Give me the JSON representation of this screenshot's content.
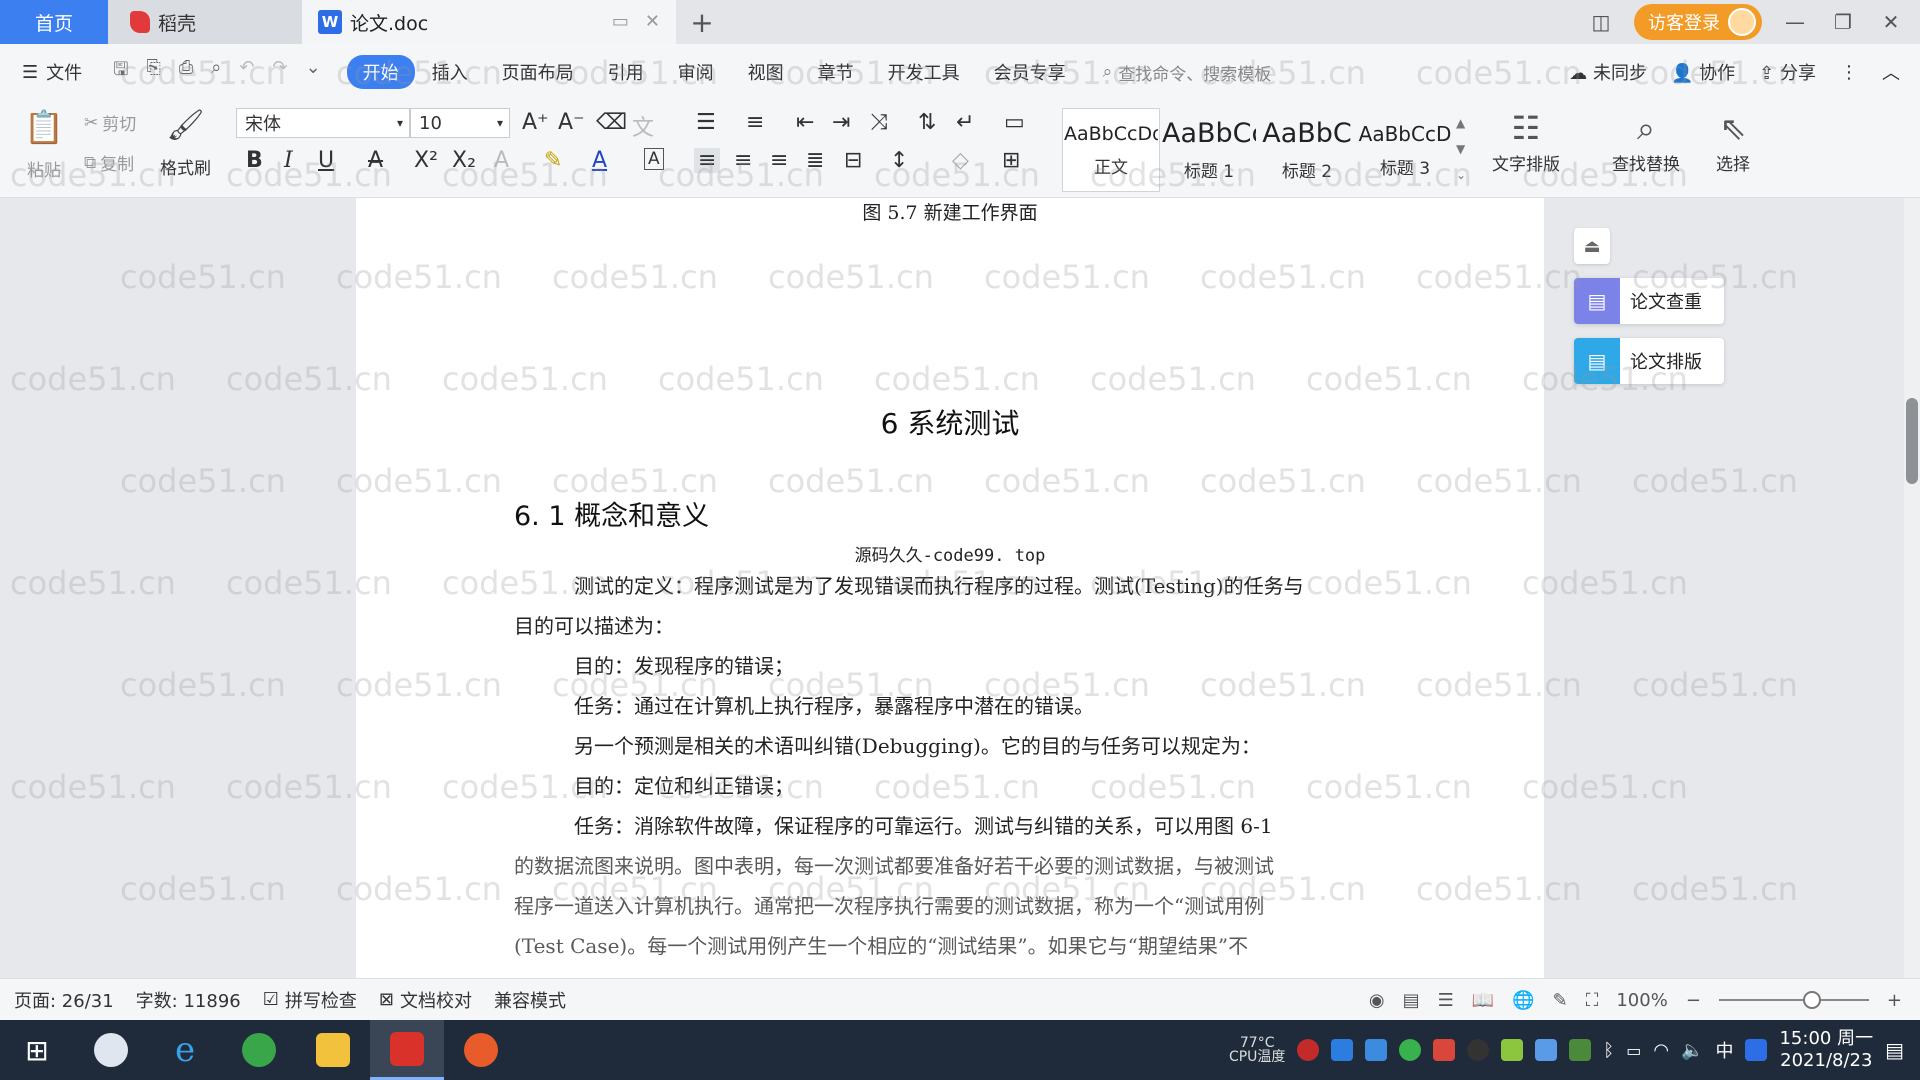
{
  "tabs": {
    "home": "首页",
    "daoke": "稻壳",
    "doc": "论文.doc",
    "doc_icon": "W",
    "new_tab": "+"
  },
  "title_right": {
    "login": "访客登录"
  },
  "menu": {
    "file": "文件",
    "items": [
      "开始",
      "插入",
      "页面布局",
      "引用",
      "审阅",
      "视图",
      "章节",
      "开发工具",
      "会员专享"
    ],
    "search_placeholder": "查找命令、搜索模板",
    "unsync": "未同步",
    "collab": "协作",
    "share": "分享"
  },
  "ribbon": {
    "paste": "粘贴",
    "cut": "剪切",
    "copy": "复制",
    "format_painter": "格式刷",
    "font_name": "宋体",
    "font_size": "10",
    "styles": [
      {
        "sample": "AaBbCcDd",
        "name": "正文"
      },
      {
        "sample": "AaBbCc",
        "name": "标题 1"
      },
      {
        "sample": "AaBbC",
        "name": "标题 2"
      },
      {
        "sample": "AaBbCcD",
        "name": "标题 3"
      }
    ],
    "text_layout": "文字排版",
    "find_replace": "查找替换",
    "select": "选择"
  },
  "document": {
    "fig_caption": "图 5.7  新建工作界面",
    "chapter_title": "6 系统测试",
    "section_title": "6. 1 概念和意义",
    "source_line": "源码久久-code99. top",
    "lines": [
      "测试的定义：程序测试是为了发现错误而执行程序的过程。测试(Testing)的任务与",
      "目的可以描述为：",
      "目的：发现程序的错误；",
      "任务：通过在计算机上执行程序，暴露程序中潜在的错误。",
      "另一个预测是相关的术语叫纠错(Debugging)。它的目的与任务可以规定为：",
      "目的：定位和纠正错误；",
      "任务：消除软件故障，保证程序的可靠运行。测试与纠错的关系，可以用图 6-1",
      "的数据流图来说明。图中表明，每一次测试都要准备好若干必要的测试数据，与被测试",
      "程序一道送入计算机执行。通常把一次程序执行需要的测试数据，称为一个“测试用例",
      "(Test Case)。每一个测试用例产生一个相应的“测试结果”。如果它与“期望结果”不"
    ]
  },
  "side_panel": {
    "check": "论文查重",
    "layout": "论文排版"
  },
  "watermark": "code51.cn",
  "status": {
    "page": "页面: 26/31",
    "words": "字数: 11896",
    "spell": "拼写检查",
    "proof": "文档校对",
    "compat": "兼容模式",
    "zoom": "100%",
    "zoom_level": 0.64
  },
  "taskbar": {
    "temp": "77°C",
    "cpu": "CPU温度",
    "ime": "中",
    "time": "15:00 周一",
    "date": "2021/8/23"
  }
}
